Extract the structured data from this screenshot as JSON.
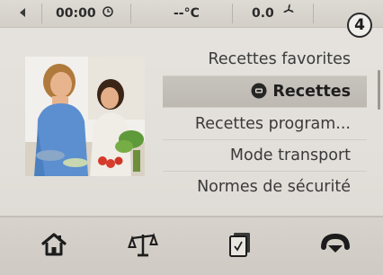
{
  "status_bar": {
    "time": "00:00",
    "time_icon": "clock-icon",
    "temperature": "--°C",
    "speed": "0.0",
    "speed_icon": "fan-icon"
  },
  "step_badge": "4",
  "photo": {
    "description_icon": "cooking-people-photo"
  },
  "menu": {
    "items": [
      {
        "label": "Recettes favorites",
        "selected": false
      },
      {
        "label": "Recettes",
        "selected": true,
        "icon": "chef-hat-icon"
      },
      {
        "label": "Recettes program...",
        "selected": false
      },
      {
        "label": "Mode transport",
        "selected": false
      },
      {
        "label": "Normes de sécurité",
        "selected": false
      }
    ]
  },
  "bottom_bar": {
    "buttons": [
      {
        "name": "home",
        "icon": "home-icon"
      },
      {
        "name": "scale",
        "icon": "scale-icon"
      },
      {
        "name": "recipe",
        "icon": "recipe-chip-icon"
      },
      {
        "name": "turbo",
        "icon": "turbo-icon"
      }
    ]
  },
  "colors": {
    "background": "#e4e1dc",
    "selected_row": "#c2beb8",
    "text": "#3a3a3a"
  }
}
